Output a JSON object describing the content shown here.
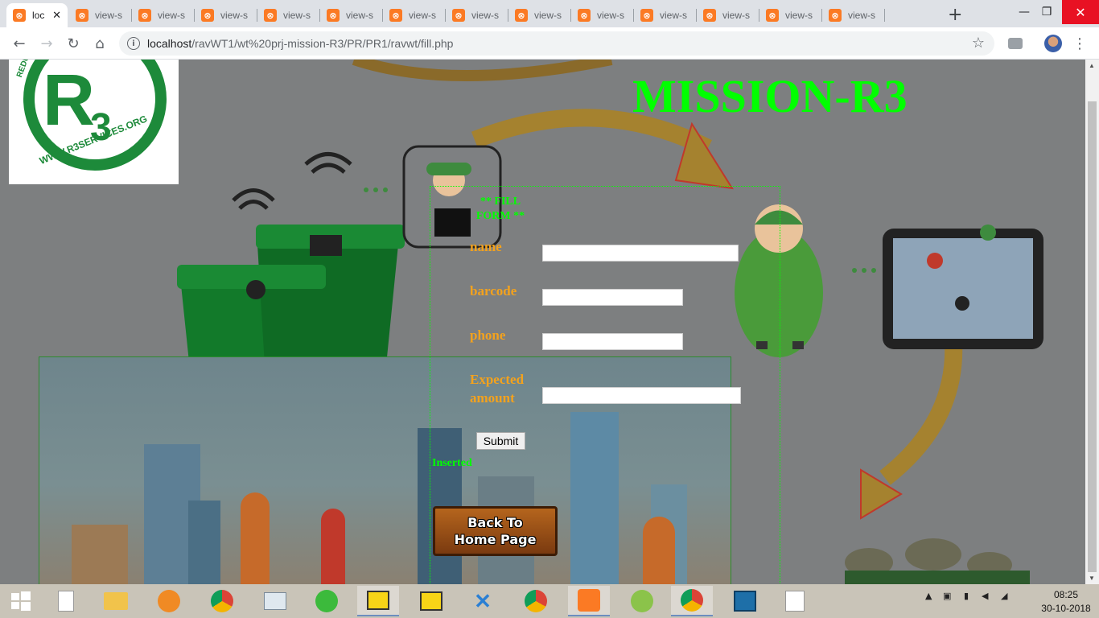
{
  "browser": {
    "tabs": [
      {
        "label": "loc",
        "active": true
      },
      {
        "label": "view-s"
      },
      {
        "label": "view-s"
      },
      {
        "label": "view-s"
      },
      {
        "label": "view-s"
      },
      {
        "label": "view-s"
      },
      {
        "label": "view-s"
      },
      {
        "label": "view-s"
      },
      {
        "label": "view-s"
      },
      {
        "label": "view-s"
      },
      {
        "label": "view-s"
      },
      {
        "label": "view-s"
      },
      {
        "label": "view-s"
      },
      {
        "label": "view-s"
      }
    ],
    "url_host": "localhost",
    "url_path": "/ravWT1/wt%20prj-mission-R3/PR/PR1/ravwt/fill.php"
  },
  "page": {
    "title": "MISSION-R3",
    "logo": {
      "letters": "R",
      "subscript": "3",
      "arc_text": "REDUCE",
      "web_text": "WWW.R3SERVICES.ORG"
    },
    "form": {
      "heading": "** FILL FORM **",
      "fields": {
        "name": {
          "label": "name",
          "value": ""
        },
        "barcode": {
          "label": "barcode",
          "value": ""
        },
        "phone": {
          "label": "phone",
          "value": ""
        },
        "amount": {
          "label_line1": "Expected",
          "label_line2": "amount",
          "value": ""
        }
      },
      "submit_label": "Submit",
      "status_text": "Inserted"
    },
    "back_button": {
      "line1": "Back To",
      "line2": "Home Page"
    }
  },
  "taskbar": {
    "time": "08:25",
    "date": "30-10-2018"
  },
  "colors": {
    "accent_green": "#00ff00",
    "label_orange": "#f3a21d",
    "xampp_orange": "#fb7a24"
  }
}
